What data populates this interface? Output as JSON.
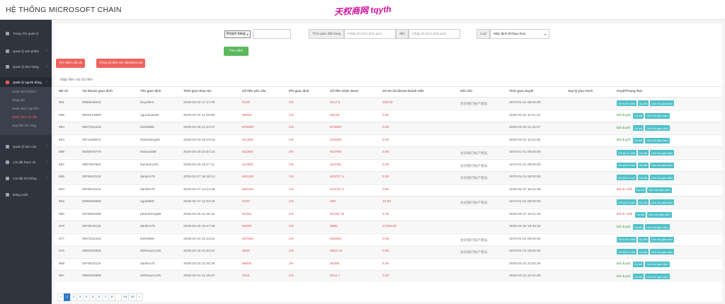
{
  "app": {
    "title": "HỆ THỐNG MICROSOFT CHAIN",
    "watermark": "天权商网 tqyth"
  },
  "sidebar": {
    "items": [
      {
        "label": "Trang chủ quản lý",
        "icon": "home-icon"
      },
      {
        "label": "Quản lý sản phẩm",
        "icon": "box-icon"
      },
      {
        "label": "Quản lý đơn hàng",
        "icon": "cart-icon"
      },
      {
        "label": "Quản lý người dùng",
        "icon": "user-icon",
        "active": true
      },
      {
        "label": "Quản lý báo cáo",
        "icon": "chart-icon"
      },
      {
        "label": "Cài đặt tham số",
        "icon": "sliders-icon"
      },
      {
        "label": "Cài đặt hệ thống",
        "icon": "gear-icon"
      },
      {
        "label": "Đăng xuất",
        "icon": "logout-icon"
      }
    ],
    "submenu": [
      "Danh sách khách",
      "Hàng đợi",
      "Danh sách nạp tiền",
      "Danh sách rút tiền",
      "Nạp tiền thủ công"
    ],
    "submenu_active": 3
  },
  "filters": {
    "customer_select": "Khách hàng",
    "time_label": "Thời gian đặt hàng",
    "start_placeholder": "Nhập đi chọn thời gian",
    "to_label": "đến",
    "end_placeholder": "Nhập đi chọn thời gian",
    "type_label": "Loại",
    "type_select": "Mặc định không chọn",
    "search_button": "Tìm kiếm",
    "search_all_button": "Tìm kiếm tất cả",
    "total_button": "Tổng số tiền rút: 4624944.35"
  },
  "panel": {
    "title": "Nạp tiền và rút tiền"
  },
  "table": {
    "headers": [
      "Mã số",
      "Tài khoản giao dịch",
      "Tên giao dịch",
      "Thời gian thao tác",
      "Số tiền yêu cầu",
      "Phí giao dịch",
      "Số tiền nhận được",
      "Số dư tài khoản thành viên",
      "Ghi chú",
      "Thời gian duyệt",
      "Đại lý phụ trách",
      "Duyệt/Trạng thái"
    ],
    "rows": [
      {
        "id": "901",
        "account": "0986546016",
        "name": "thuydiem",
        "time": "2025-04-02 17:17:30",
        "amount": "¥120",
        "fee": "2%",
        "received": "¥117.6",
        "balance": "100.00",
        "note": "会员银行账户错误",
        "approved": "1970-01-01 08:00:00",
        "status": "",
        "buttons": [
          "Xử lý/Từ chối",
          "Ký kết",
          "Lịch sử giao dịch"
        ]
      },
      {
        "id": "895",
        "account": "0945313989",
        "name": "nguoituan80",
        "time": "2025-03-31 11:50:55",
        "amount": "¥6250",
        "fee": "2%",
        "received": "¥6125",
        "balance": "0.00",
        "note": "",
        "approved": "2025-03-31 11:51:14",
        "status": "Đã duyệt",
        "buttons": [
          "Ký kết",
          "Lịch sử giao dịch"
        ]
      },
      {
        "id": "894",
        "account": "0907222444",
        "name": "binh6868",
        "time": "2025-03-30 21:24:47",
        "amount": "¥75000",
        "fee": "2%",
        "received": "¥73500",
        "balance": "0.00",
        "note": "",
        "approved": "2025-03-30 21:41:57",
        "status": "Đã duyệt",
        "buttons": [
          "Ký kết",
          "Lịch sử giao dịch"
        ]
      },
      {
        "id": "893",
        "account": "0973459672",
        "name": "thanhdong00",
        "time": "2025-03-30 19:19:53",
        "amount": "¥11050",
        "fee": "2%",
        "received": "¥10829",
        "balance": "0.00",
        "note": "",
        "approved": "2025-03-31 11:51:05",
        "status": "Đã duyệt",
        "buttons": [
          "Ký kết",
          "Lịch sử giao dịch"
        ]
      },
      {
        "id": "889",
        "account": "0935878778",
        "name": "trantuan88",
        "time": "2025-03-29 22:57:24",
        "amount": "¥11000",
        "fee": "2%",
        "received": "¥10780",
        "balance": "0.00",
        "note": "会员银行账户错误",
        "approved": "1970-01-01 08:00:00",
        "status": "",
        "buttons": [
          "Xử lý/Từ chối",
          "Ký kết",
          "Lịch sử giao dịch"
        ]
      },
      {
        "id": "887",
        "account": "0897657852",
        "name": "buivanluc00",
        "time": "2025-03-29 18:27:11",
        "amount": "¥11000",
        "fee": "2%",
        "received": "¥10780",
        "balance": "0.00",
        "note": "会员银行账户错误",
        "approved": "1970-01-01 08:00:00",
        "status": "",
        "buttons": [
          "Xử lý/Từ chối",
          "Ký kết",
          "Lịch sử giao dịch"
        ]
      },
      {
        "id": "885",
        "account": "0979543119",
        "name": "dankim75",
        "time": "2025-03-27 16:38:13",
        "amount": "¥20130",
        "fee": "2%",
        "received": "¥19727.4",
        "balance": "0.00",
        "note": "会员银行账户错误",
        "approved": "1970-01-01 08:00:00",
        "status": "",
        "buttons": [
          "Xử lý/Từ chối",
          "Ký kết",
          "Lịch sử giao dịch"
        ]
      },
      {
        "id": "883",
        "account": "0979543119",
        "name": "dankim75",
        "time": "2025-03-27 14:14:29",
        "amount": "¥20130",
        "fee": "2%",
        "received": "¥19727.4",
        "balance": "0.00",
        "note": "",
        "approved": "2025-03-27 16:21:36",
        "status": "Đã từ chối",
        "buttons": [
          "Ký kết",
          "Lịch sử giao dịch"
        ]
      },
      {
        "id": "882",
        "account": "0365280668",
        "name": "ngai6868",
        "time": "2025-03-27 14:03:16",
        "amount": "¥100",
        "fee": "2%",
        "received": "¥98",
        "balance": "10.00",
        "note": "会员银行账户错误",
        "approved": "1970-01-01 08:00:00",
        "status": "",
        "buttons": [
          "Xử lý/Từ chối",
          "Ký kết",
          "Lịch sử giao dịch"
        ]
      },
      {
        "id": "880",
        "account": "0378583498",
        "name": "phamthong88",
        "time": "2025-03-26 11:20:15",
        "amount": "¥1261",
        "fee": "2%",
        "received": "¥1235.78",
        "balance": "0.70",
        "note": "",
        "approved": "2025-03-27 16:21:40",
        "status": "Đã từ chối",
        "buttons": [
          "Ký kết",
          "Lịch sử giao dịch"
        ]
      },
      {
        "id": "878",
        "account": "0979543119",
        "name": "dankim75",
        "time": "2025-03-25 16:47:38",
        "amount": "¥1000",
        "fee": "2%",
        "received": "¥980",
        "balance": "17205.00",
        "note": "",
        "approved": "2025-03-25 19:32:22",
        "status": "Đã duyệt",
        "buttons": [
          "Ký kết",
          "Lịch sử giao dịch"
        ]
      },
      {
        "id": "877",
        "account": "0907222444",
        "name": "binh6868",
        "time": "2025-03-24 22:13:51",
        "amount": "¥37000",
        "fee": "2%",
        "received": "¥36260",
        "balance": "0.00",
        "note": "会员银行账户错误",
        "approved": "1970-01-01 08:00:00",
        "status": "",
        "buttons": [
          "Xử lý/Từ chối",
          "Ký kết",
          "Lịch sử giao dịch"
        ]
      },
      {
        "id": "875",
        "account": "0869320908",
        "name": "dinhtoan1225",
        "time": "2025-03-24 22:22:01",
        "amount": "¥839",
        "fee": "2%",
        "received": "¥822.22",
        "balance": "0.50",
        "note": "会员银行账户错误",
        "approved": "1970-01-01 08:00:00",
        "status": "",
        "buttons": [
          "Xử lý/Từ chối",
          "Ký kết",
          "Lịch sử giao dịch"
        ]
      },
      {
        "id": "868",
        "account": "0979543119",
        "name": "dankim75",
        "time": "2025-03-22 22:45:39",
        "amount": "¥5500",
        "fee": "2%",
        "received": "¥5390",
        "balance": "5.00",
        "note": "",
        "approved": "2025-03-22 22:52:25",
        "status": "Đã duyệt",
        "buttons": [
          "Ký kết",
          "Lịch sử giao dịch"
        ]
      },
      {
        "id": "867",
        "account": "0869320908",
        "name": "dinhtoan1225",
        "time": "2025-03-21 21:48:37",
        "amount": "¥115",
        "fee": "2%",
        "received": "¥112.7",
        "balance": "0.00",
        "note": "",
        "approved": "2025-03-21 22:21:29",
        "status": "Đã duyệt",
        "buttons": [
          "Ký kết",
          "Lịch sử giao dịch"
        ]
      }
    ]
  },
  "pagination": {
    "pages": [
      "«",
      "1",
      "2",
      "3",
      "4",
      "5",
      "6",
      "7",
      "8",
      "...",
      "18",
      "19",
      "»"
    ],
    "current": "1"
  },
  "colors": {
    "sidebar": "#2f353f",
    "accent_red": "#f0625d",
    "green": "#5cb85c",
    "teal": "#4fc1c9",
    "money_red": "#d9534f"
  }
}
